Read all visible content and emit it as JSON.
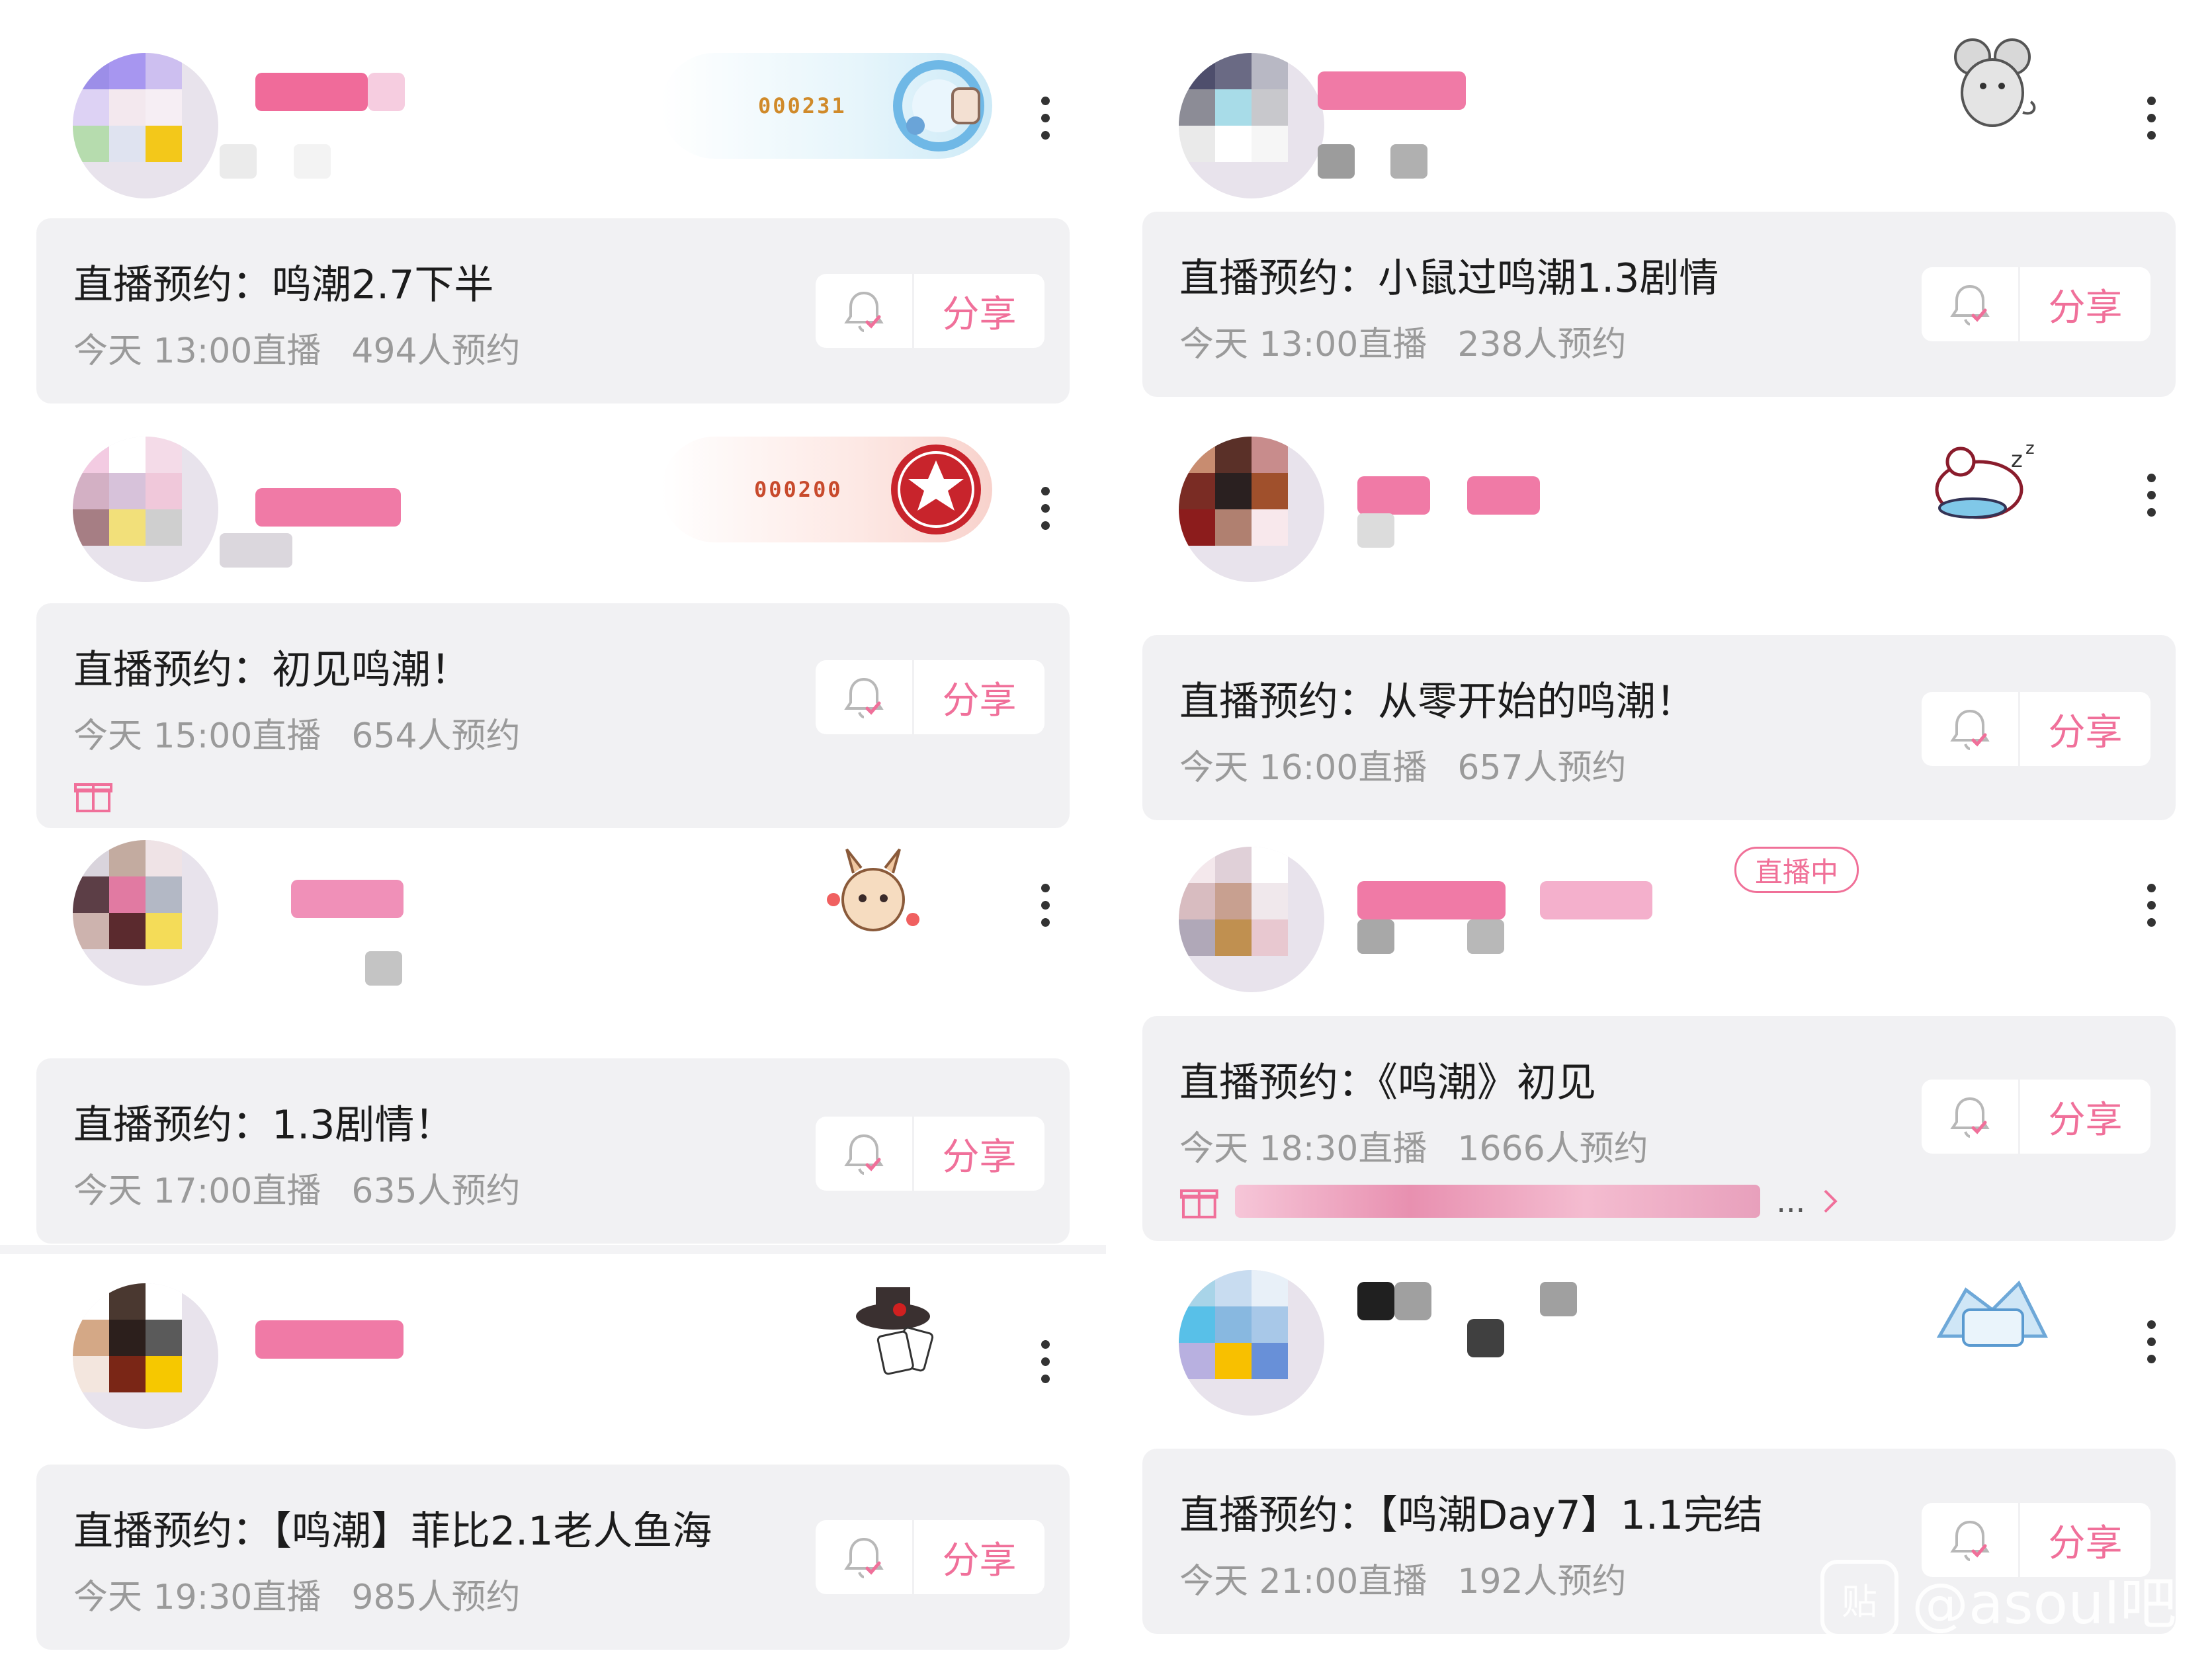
{
  "accent_color": "#f0709a",
  "card_label_prefix": "直播预约：",
  "share_label": "分享",
  "live_label": "直播中",
  "left_column": [
    {
      "badge_number": "000231",
      "title": "鸣潮2.7下半",
      "time": "今天 13:00直播",
      "count": "494人预约"
    },
    {
      "badge_number": "000200",
      "title": "初见鸣潮！",
      "time": "今天 15:00直播",
      "count": "654人预约",
      "gift": true
    },
    {
      "title": "1.3剧情！",
      "time": "今天 17:00直播",
      "count": "635人预约"
    },
    {
      "title": "【鸣潮】菲比2.1老人鱼海",
      "time": "今天 19:30直播",
      "count": "985人预约"
    }
  ],
  "right_column": [
    {
      "title": "小鼠过鸣潮1.3剧情",
      "time": "今天 13:00直播",
      "count": "238人预约"
    },
    {
      "title": "从零开始的鸣潮！",
      "time": "今天 16:00直播",
      "count": "657人预约"
    },
    {
      "title": "《鸣潮》初见",
      "time": "今天 18:30直播",
      "count": "1666人预约",
      "live": true,
      "gift_suffix": "...",
      "gift": true
    },
    {
      "title": "【鸣潮Day7】1.1完结",
      "time": "今天 21:00直播",
      "count": "192人预约"
    }
  ],
  "watermark": {
    "text": "@asoul吧",
    "logo": "贴"
  },
  "icons": {
    "more": "more-vertical-icon",
    "bell": "bell-check-icon",
    "gift": "gift-icon",
    "chevron": "chevron-right-icon"
  }
}
